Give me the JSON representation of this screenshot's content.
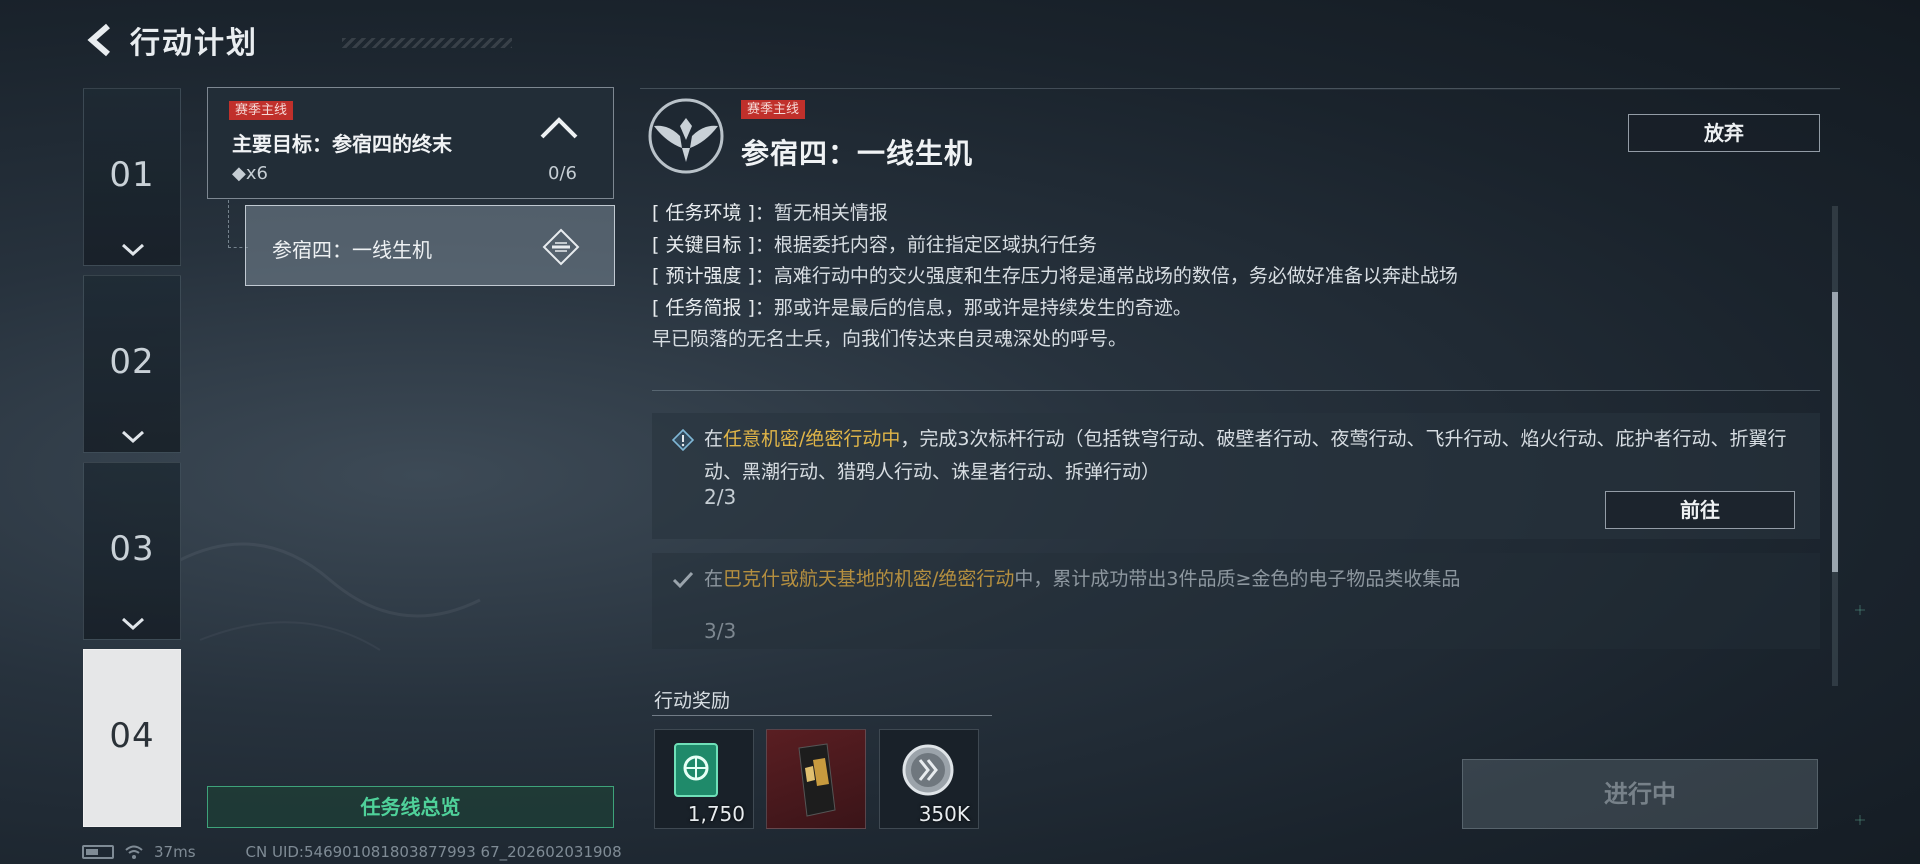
{
  "header": {
    "title": "行动计划"
  },
  "chapters": [
    {
      "label": "01"
    },
    {
      "label": "02"
    },
    {
      "label": "03"
    },
    {
      "label": "04"
    }
  ],
  "mission": {
    "tag": "赛季主线",
    "name": "主要目标：参宿四的终末",
    "count": "◆x6",
    "progress": "0/6",
    "sub": {
      "name": "参宿四：一线生机"
    }
  },
  "overview_label": "任务线总览",
  "status": {
    "ping": "37ms",
    "uid": "CN UID:546901081803877993 67_202602031908"
  },
  "detail": {
    "tag": "赛季主线",
    "title": "参宿四：一线生机",
    "abandon_label": "放弃",
    "info": [
      {
        "label": "[ 任务环境 ]",
        "text": "：暂无相关情报"
      },
      {
        "label": "[ 关键目标 ]",
        "text": "：根据委托内容，前往指定区域执行任务"
      },
      {
        "label": "[ 预计强度 ]",
        "text": "：高难行动中的交火强度和生存压力将是通常战场的数倍，务必做好准备以奔赴战场"
      },
      {
        "label": "[ 任务简报 ]",
        "text": "：那或许是最后的信息，那或许是持续发生的奇迹。"
      }
    ],
    "info_extra": "早已陨落的无名士兵，向我们传达来自灵魂深处的呼号。",
    "objectives": [
      {
        "pre": "在",
        "highlight": "任意机密/绝密行动中",
        "post": "，完成3次标杆行动（包括铁穹行动、破壁者行动、夜莺行动、飞升行动、焰火行动、庇护者行动、折翼行动、黑潮行动、猎鸦人行动、诛星者行动、拆弹行动）",
        "progress": "2/3",
        "button": "前往"
      },
      {
        "pre": "在",
        "highlight": "巴克什或航天基地的机密/绝密行动",
        "post": "中，累计成功带出3件品质≥金色的电子物品类收集品",
        "progress": "3/3"
      }
    ],
    "rewards_label": "行动奖励",
    "rewards": [
      {
        "qty": "1,750",
        "icon": "green-badge-icon"
      },
      {
        "qty": "",
        "icon": "supply-bag-icon"
      },
      {
        "qty": "350K",
        "icon": "silver-coin-icon"
      }
    ],
    "status_button": "进行中"
  }
}
